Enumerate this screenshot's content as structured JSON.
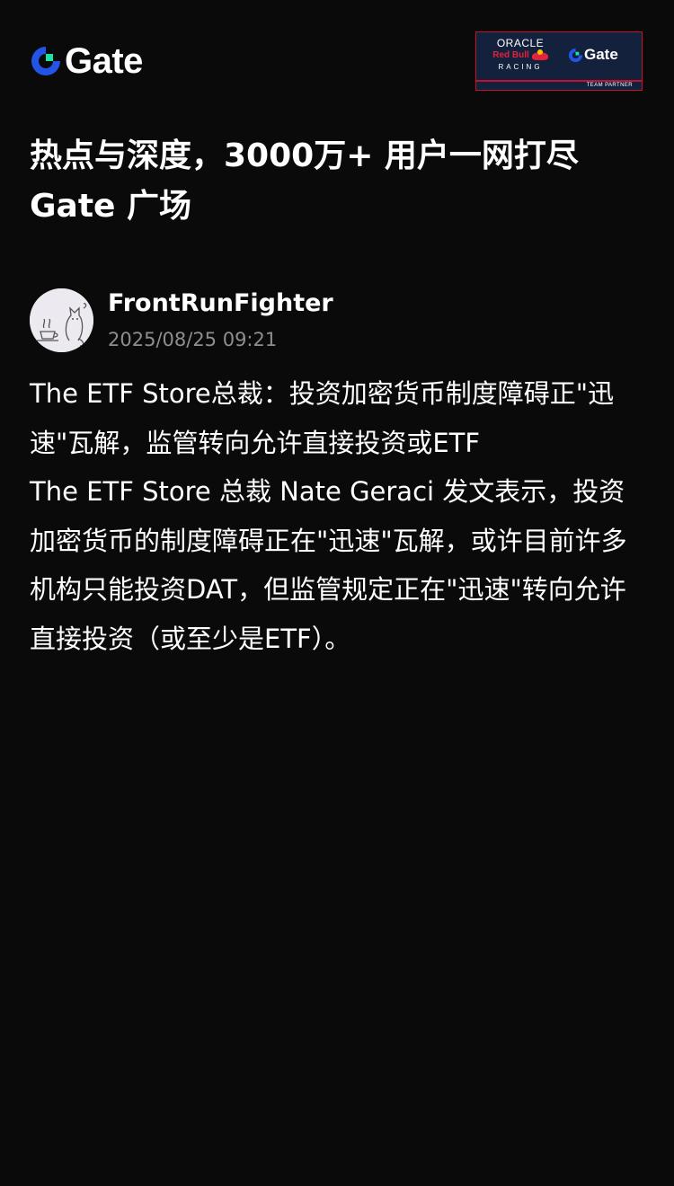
{
  "header": {
    "brand": "Gate",
    "partner_badge": {
      "line1": "ORACLE",
      "line2": "Red Bull",
      "line3": "RACING",
      "brand": "Gate",
      "footer": "TEAM PARTNER"
    }
  },
  "headline": "热点与深度，3000万+ 用户一网打尽 Gate 广场",
  "author": {
    "name": "FrontRunFighter",
    "timestamp": "2025/08/25 09:21"
  },
  "post": {
    "title": "The ETF Store总裁：投资加密货币制度障碍正\"迅速\"瓦解，监管转向允许直接投资或ETF",
    "body": "The ETF Store 总裁 Nate Geraci 发文表示，投资加密货币的制度障碍正在\"迅速\"瓦解，或许目前许多机构只能投资DAT，但监管规定正在\"迅速\"转向允许直接投资（或至少是ETF）。"
  },
  "colors": {
    "background": "#0a0a0a",
    "text": "#ffffff",
    "muted": "#8e8e8e",
    "brand_blue": "#2354e6",
    "brand_green": "#17e5a1"
  },
  "icons": [
    "gate-logo-icon",
    "avatar-cat-icon"
  ]
}
